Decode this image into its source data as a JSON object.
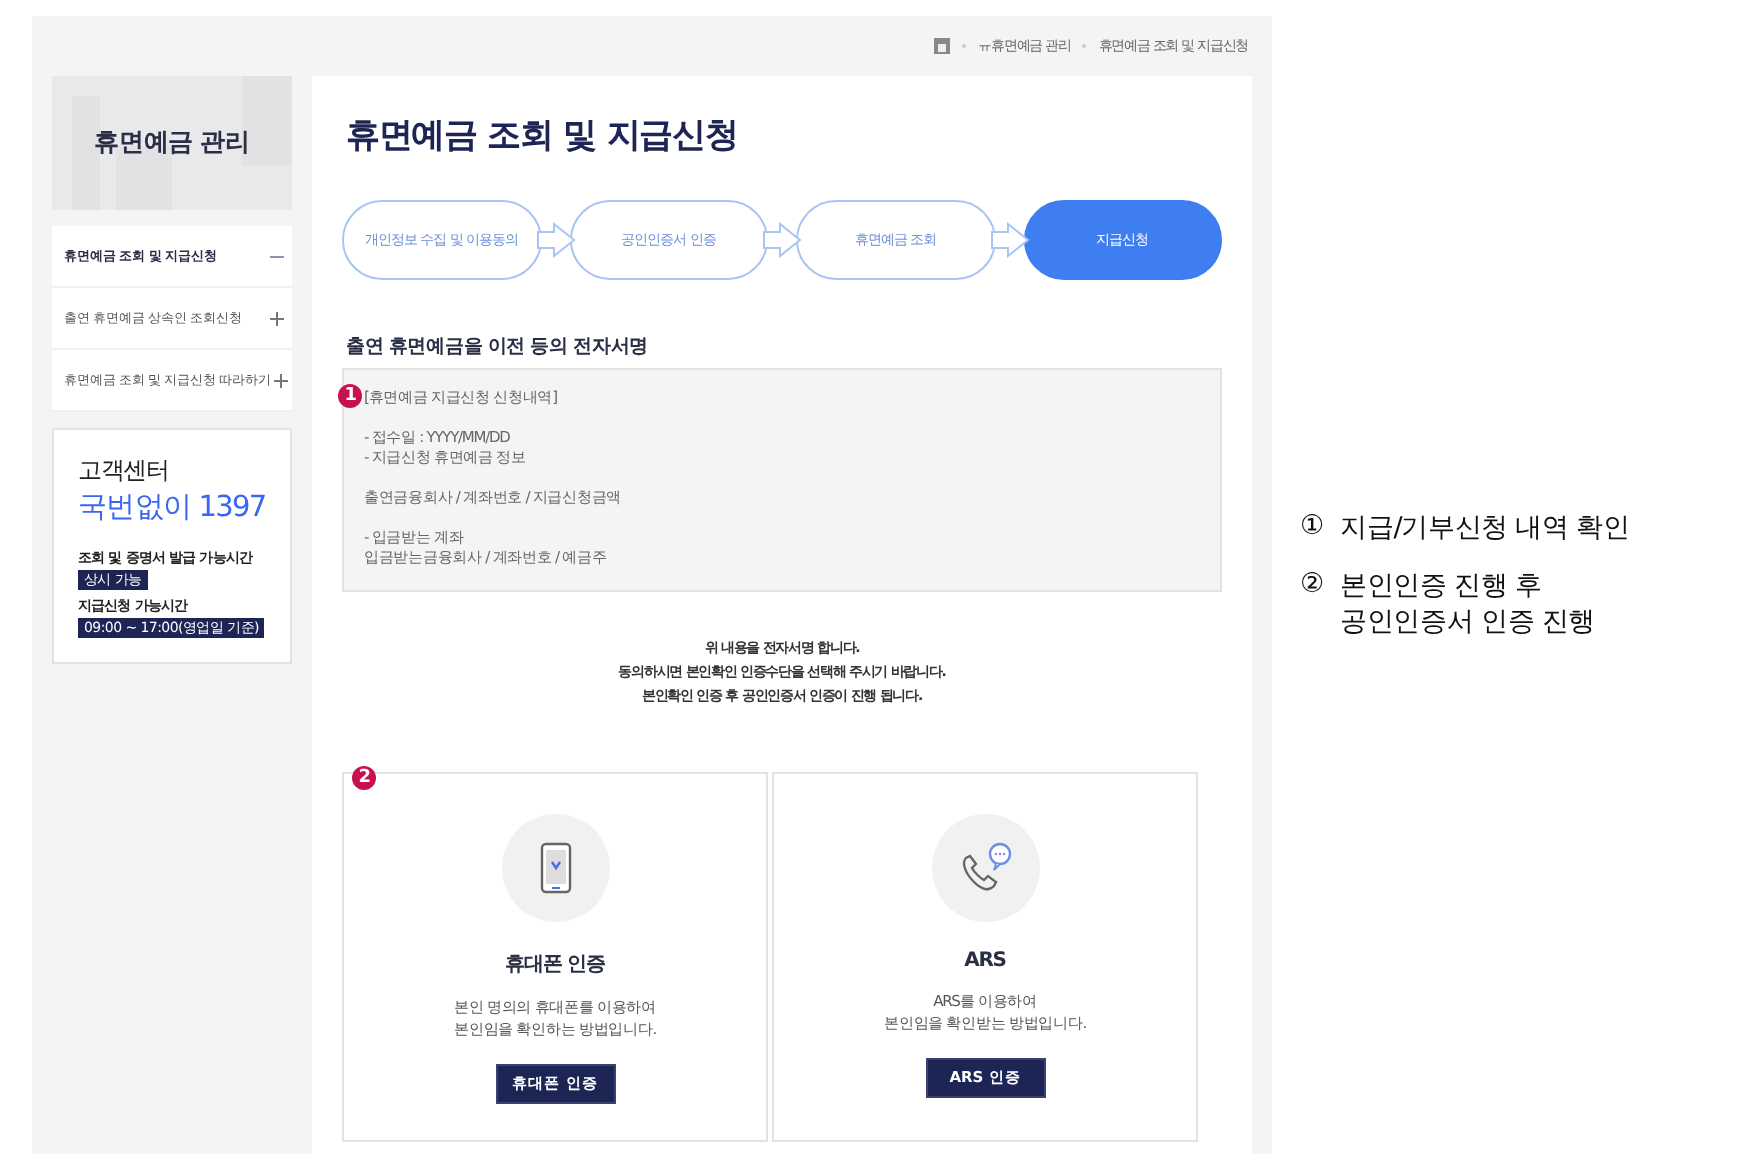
{
  "breadcrumb": [
    "ㅠ휴면예금 관리",
    "휴면예금 조회 및 지급신청"
  ],
  "sidebar": {
    "title": "휴면예금 관리",
    "items": [
      {
        "label": "휴면예금 조회 및 지급신청",
        "expanded": true
      },
      {
        "label": "출연 휴면예금 상속인 조회신청",
        "expanded": false
      },
      {
        "label": "휴면예금 조회 및 지급신청 따라하기",
        "expanded": false
      }
    ]
  },
  "contact": {
    "title": "고객센터",
    "phone": "국번없이 1397",
    "hours": [
      {
        "label": "조회 및 증명서 발급 가능시간",
        "value": "상시 가능"
      },
      {
        "label": "지급신청 가능시간",
        "value": "09:00 ~ 17:00(영업일 기준)"
      }
    ]
  },
  "page_title": "휴면예금 조회 및 지급신청",
  "steps": [
    {
      "label": "개인정보 수집 및 이용동의",
      "selected": false
    },
    {
      "label": "공인인증서 인증",
      "selected": false
    },
    {
      "label": "휴면예금 조회",
      "selected": false
    },
    {
      "label": "지급신청",
      "selected": true
    }
  ],
  "section_title": "출연 휴면예금을 이전 등의 전자서명",
  "details": {
    "badge": "1",
    "paragraphs": [
      [
        "[휴면예금 지급신청 신청내역]"
      ],
      [
        "- 접수일 : YYYY/MM/DD",
        "- 지급신청 휴면예금 정보"
      ],
      [
        "출연금융회사 / 계좌번호 / 지급신청금액"
      ],
      [
        "- 입금받는 계좌",
        "입금받는금융회사 / 계좌번호 / 예금주"
      ]
    ]
  },
  "notice": [
    "위 내용을 전자서명 합니다.",
    "동의하시면 본인확인 인증수단을 선택해 주시기 바랍니다.",
    "본인확인 인증 후 공인인증서 인증이 진행 됩니다."
  ],
  "auth_badge": "2",
  "auth_methods": [
    {
      "kind": "phone",
      "title": "휴대폰 인증",
      "description": [
        "본인 명의의 휴대폰를 이용하여",
        "본인임을 확인하는 방법입니다."
      ],
      "button": "휴대폰 인증"
    },
    {
      "kind": "ars",
      "title": "ARS",
      "description": [
        "ARS를 이용하여",
        "본인임을 확인받는 방법입니다."
      ],
      "button": "ARS 인증"
    }
  ],
  "annotations": [
    {
      "mark": "①",
      "lines": [
        "지급/기부신청 내역 확인"
      ]
    },
    {
      "mark": "②",
      "lines": [
        "본인인증 진행 후",
        "공인인증서 인증 진행"
      ]
    }
  ]
}
